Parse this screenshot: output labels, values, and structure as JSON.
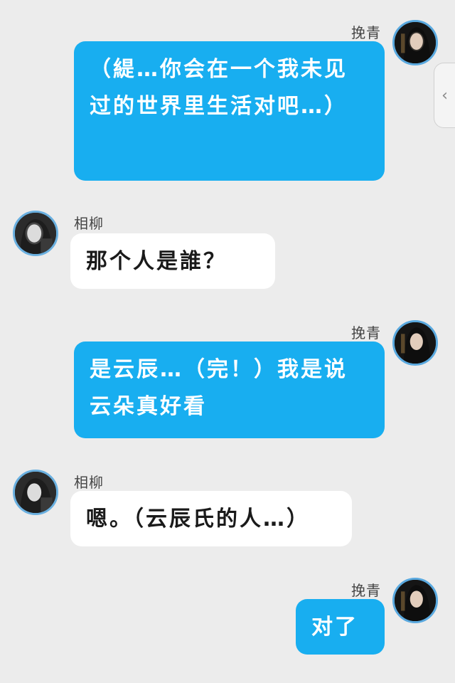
{
  "colors": {
    "background": "#ececec",
    "self_bubble": "#18aef0",
    "other_bubble": "#ffffff",
    "avatar_ring": "#5aa9df"
  },
  "side_tab": {
    "icon": "chevron-left-icon",
    "glyph": "‹"
  },
  "messages": [
    {
      "sender": "挽青",
      "side": "right",
      "text": "（緹…你会在一个我未见过的世界里生活对吧…）"
    },
    {
      "sender": "相柳",
      "side": "left",
      "text": "那个人是誰？"
    },
    {
      "sender": "挽青",
      "side": "right",
      "text": "是云辰…（完！）我是说云朵真好看"
    },
    {
      "sender": "相柳",
      "side": "left",
      "text": "嗯。（云辰氏的人…）"
    },
    {
      "sender": "挽青",
      "side": "right",
      "text": "对了"
    }
  ]
}
